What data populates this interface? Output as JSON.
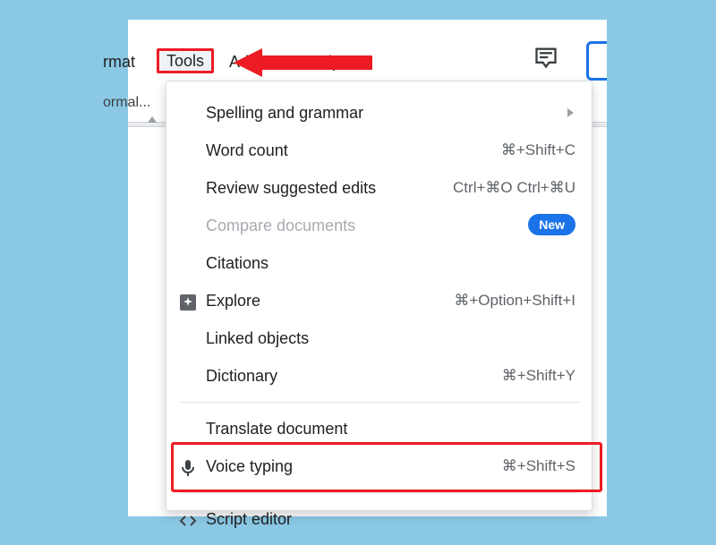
{
  "menubar": {
    "format": "rmat",
    "tools": "Tools",
    "addons": "Add-ons",
    "help": "Help",
    "normal_frag": "ormal..."
  },
  "dropdown": {
    "items": {
      "spelling": {
        "label": "Spelling and grammar",
        "shortcut": ""
      },
      "wordcount": {
        "label": "Word count",
        "shortcut": "⌘+Shift+C"
      },
      "review": {
        "label": "Review suggested edits",
        "shortcut": "Ctrl+⌘O Ctrl+⌘U"
      },
      "compare": {
        "label": "Compare documents",
        "badge": "New"
      },
      "citations": {
        "label": "Citations",
        "shortcut": ""
      },
      "explore": {
        "label": "Explore",
        "shortcut": "⌘+Option+Shift+I"
      },
      "linked": {
        "label": "Linked objects",
        "shortcut": ""
      },
      "dictionary": {
        "label": "Dictionary",
        "shortcut": "⌘+Shift+Y"
      },
      "translate": {
        "label": "Translate document",
        "shortcut": ""
      },
      "voice": {
        "label": "Voice typing",
        "shortcut": "⌘+Shift+S"
      },
      "script": {
        "label": "Script editor",
        "shortcut": ""
      }
    }
  }
}
